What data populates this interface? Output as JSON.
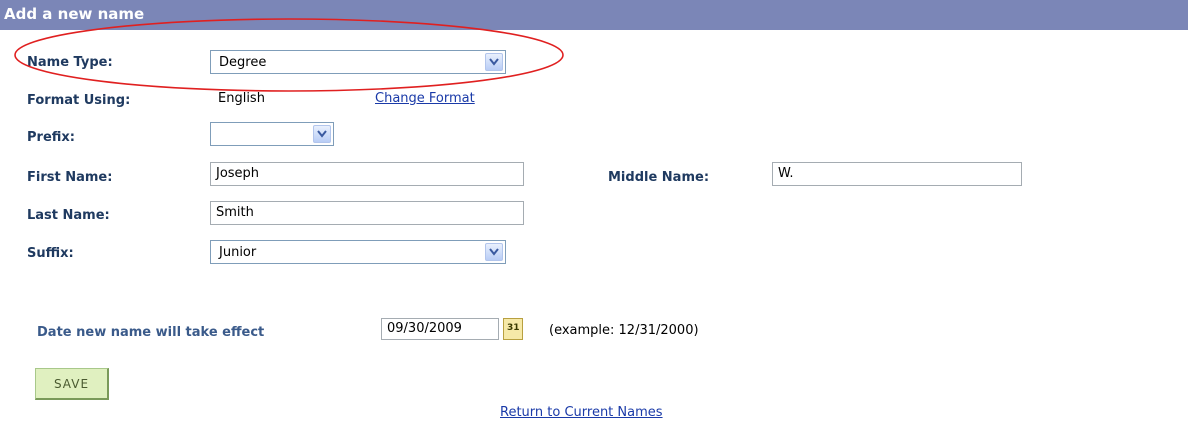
{
  "header": {
    "title": "Add a new name"
  },
  "form": {
    "name_type": {
      "label": "Name Type:",
      "value": "Degree"
    },
    "format_using": {
      "label": "Format Using:",
      "value": "English",
      "change_link": "Change Format"
    },
    "prefix": {
      "label": "Prefix:",
      "value": ""
    },
    "first_name": {
      "label": "First Name:",
      "value": "Joseph"
    },
    "middle_name": {
      "label": "Middle Name:",
      "value": "W."
    },
    "last_name": {
      "label": "Last Name:",
      "value": "Smith"
    },
    "suffix": {
      "label": "Suffix:",
      "value": "Junior"
    },
    "effective_date": {
      "label": "Date new name will take effect",
      "value": "09/30/2009",
      "example": "(example: 12/31/2000)",
      "calendar_icon_text": "31"
    }
  },
  "actions": {
    "save_label": "SAVE",
    "return_link": "Return to Current Names"
  },
  "colors": {
    "header_bg": "#7b86b7",
    "annotation_ellipse": "#e02020",
    "save_bg": "#e0f0c0",
    "link": "#1a3aa8"
  },
  "icons": {
    "dropdown": "chevron-down-icon",
    "calendar": "calendar-icon"
  }
}
